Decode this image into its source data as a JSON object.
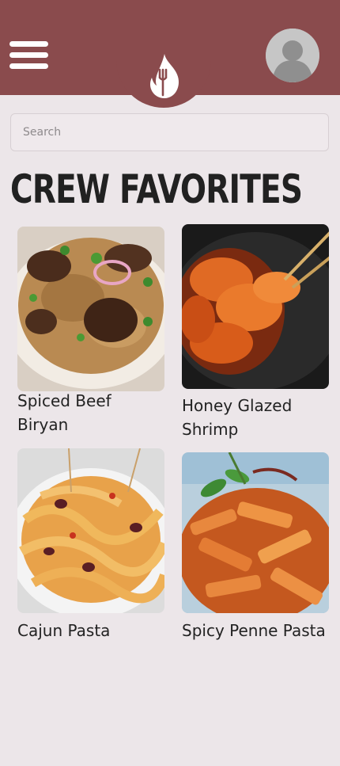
{
  "header": {
    "menu_icon": "hamburger-menu-icon",
    "logo_icon": "flame-fork-logo-icon",
    "avatar_icon": "user-avatar-icon",
    "brand_color": "#8a4b4d"
  },
  "search": {
    "placeholder": "Search"
  },
  "section": {
    "title": "CREW FAVORITES"
  },
  "recipes": [
    {
      "name": "Spiced Beef Biryan",
      "line1": "Spiced Beef",
      "line2": "Biryan"
    },
    {
      "name": "Honey Glazed Shrimp",
      "line1": "Honey Glazed",
      "line2": "Shrimp"
    },
    {
      "name": "Cajun Pasta"
    },
    {
      "name": "Spicy Penne Pasta"
    }
  ]
}
